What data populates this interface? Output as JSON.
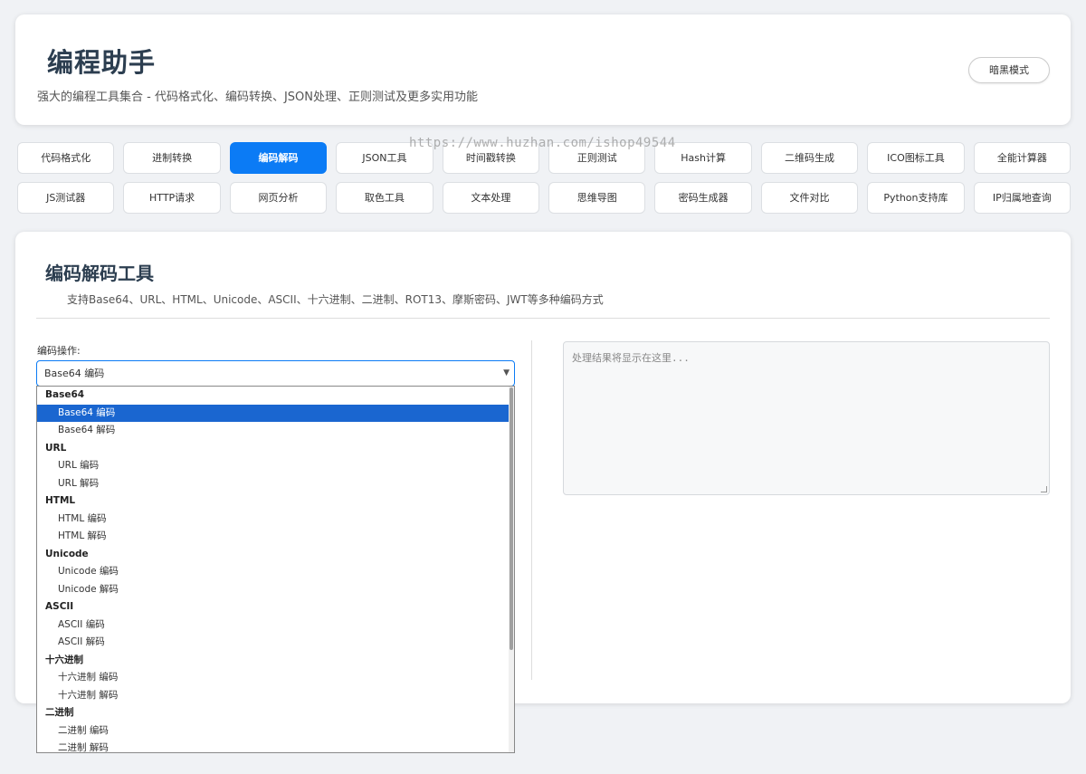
{
  "header": {
    "title": "编程助手",
    "subtitle": "强大的编程工具集合 - 代码格式化、编码转换、JSON处理、正则测试及更多实用功能",
    "dark_mode_label": "暗黑模式"
  },
  "watermark": "https://www.huzhan.com/ishop49544",
  "tabs": {
    "row1": [
      "代码格式化",
      "进制转换",
      "编码解码",
      "JSON工具",
      "时间戳转换",
      "正则测试",
      "Hash计算",
      "二维码生成",
      "ICO图标工具",
      "全能计算器"
    ],
    "row2": [
      "JS测试器",
      "HTTP请求",
      "网页分析",
      "取色工具",
      "文本处理",
      "思维导图",
      "密码生成器",
      "文件对比",
      "Python支持库",
      "IP归属地查询"
    ],
    "active": "编码解码"
  },
  "panel": {
    "title": "编码解码工具",
    "description": "支持Base64、URL、HTML、Unicode、ASCII、十六进制、二进制、ROT13、摩斯密码、JWT等多种编码方式",
    "operation_label": "编码操作:",
    "selected_operation": "Base64 编码",
    "output_placeholder": "处理结果将显示在这里..."
  },
  "dropdown": {
    "groups": [
      {
        "label": "Base64",
        "options": [
          "Base64 编码",
          "Base64 解码"
        ]
      },
      {
        "label": "URL",
        "options": [
          "URL 编码",
          "URL 解码"
        ]
      },
      {
        "label": "HTML",
        "options": [
          "HTML 编码",
          "HTML 解码"
        ]
      },
      {
        "label": "Unicode",
        "options": [
          "Unicode 编码",
          "Unicode 解码"
        ]
      },
      {
        "label": "ASCII",
        "options": [
          "ASCII 编码",
          "ASCII 解码"
        ]
      },
      {
        "label": "十六进制",
        "options": [
          "十六进制 编码",
          "十六进制 解码"
        ]
      },
      {
        "label": "二进制",
        "options": [
          "二进制 编码",
          "二进制 解码"
        ]
      }
    ],
    "selected": "Base64 编码"
  },
  "colors": {
    "accent": "#0b7bf5",
    "selected_option": "#1a66d0",
    "title_text": "#2c3e50",
    "background": "#f0f2f5"
  }
}
